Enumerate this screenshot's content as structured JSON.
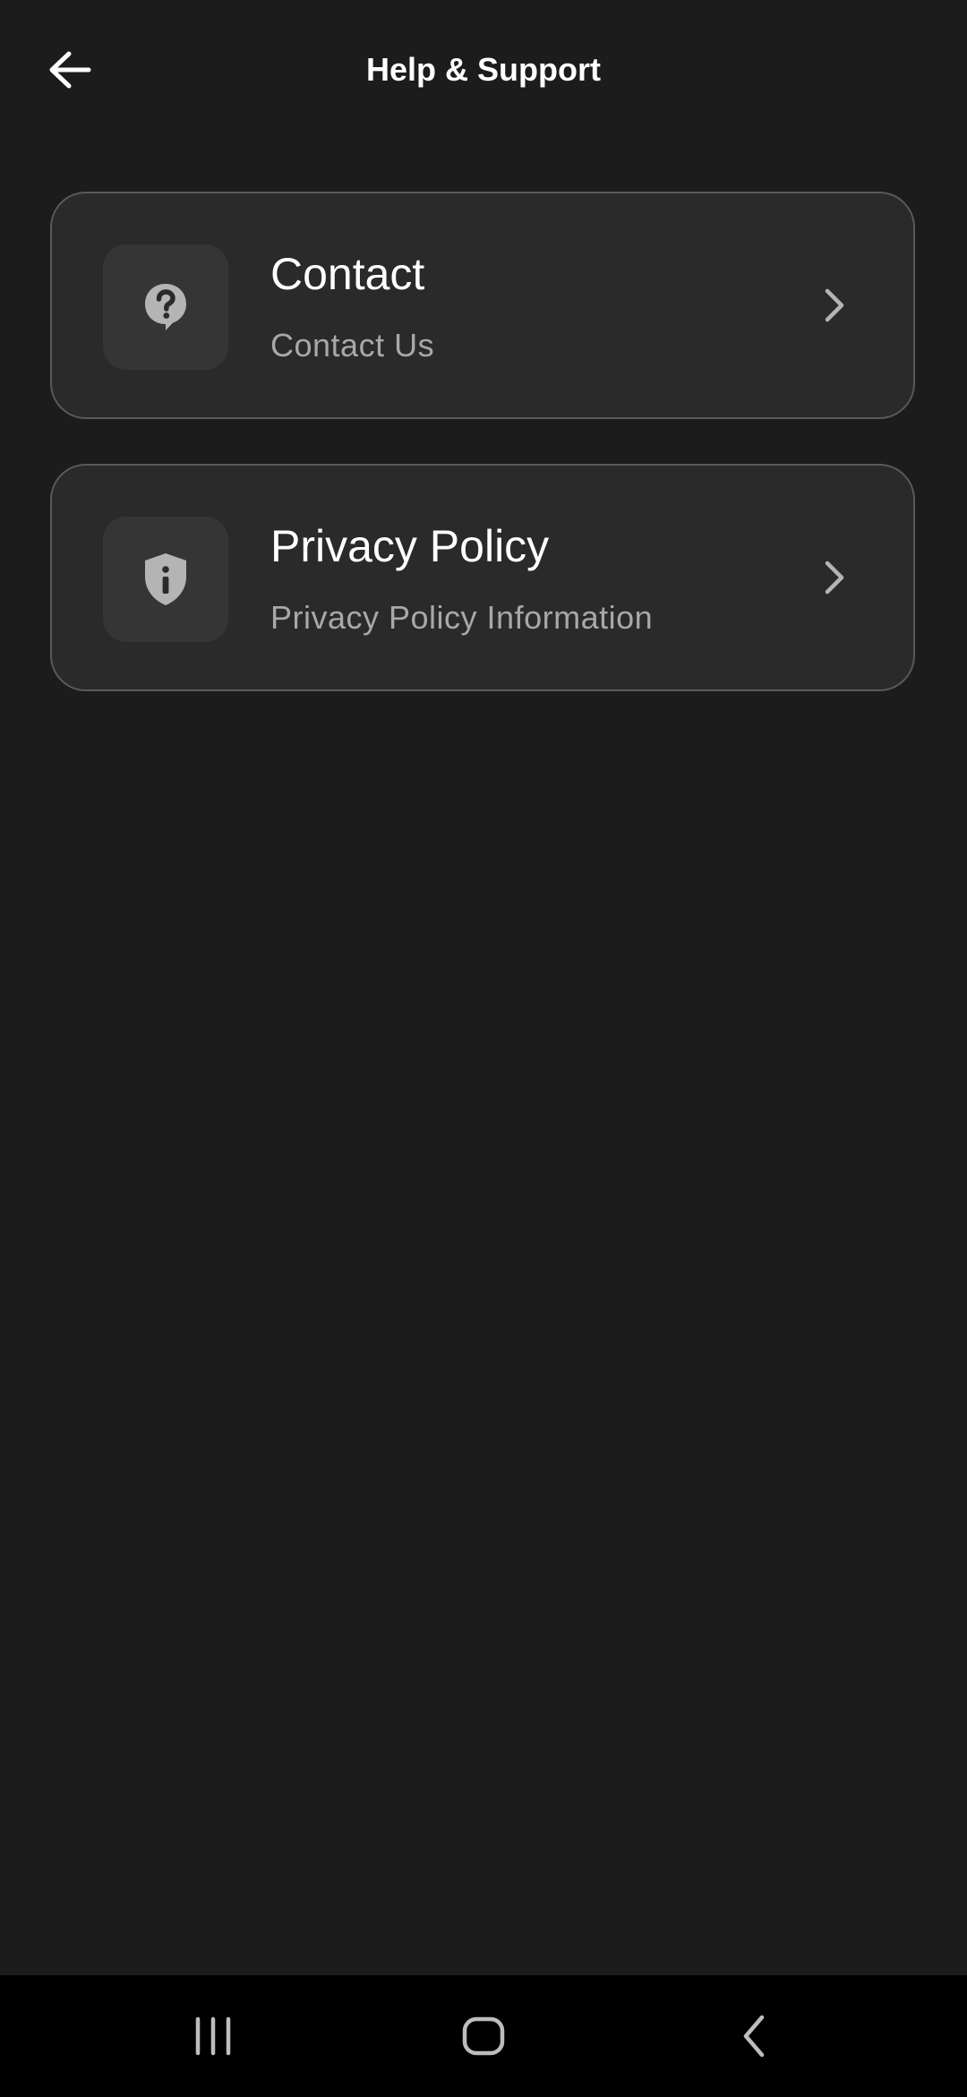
{
  "header": {
    "title": "Help & Support",
    "back_icon": "arrow-left-icon"
  },
  "menu": {
    "items": [
      {
        "title": "Contact",
        "subtitle": "Contact Us",
        "icon": "question-circle-icon",
        "chevron_icon": "chevron-right-icon"
      },
      {
        "title": "Privacy Policy",
        "subtitle": "Privacy Policy Information",
        "icon": "shield-info-icon",
        "chevron_icon": "chevron-right-icon"
      }
    ]
  },
  "system_nav": {
    "recents_icon": "recents-icon",
    "home_icon": "home-icon",
    "back_icon": "nav-back-icon"
  },
  "colors": {
    "background": "#1c1c1c",
    "card_background": "#2a2a2a",
    "card_border": "#5a5a5a",
    "icon_box": "#353535",
    "icon_gray": "#b4b4b4",
    "subtitle_text": "#a8a8a8",
    "nav_bar": "#000000"
  }
}
